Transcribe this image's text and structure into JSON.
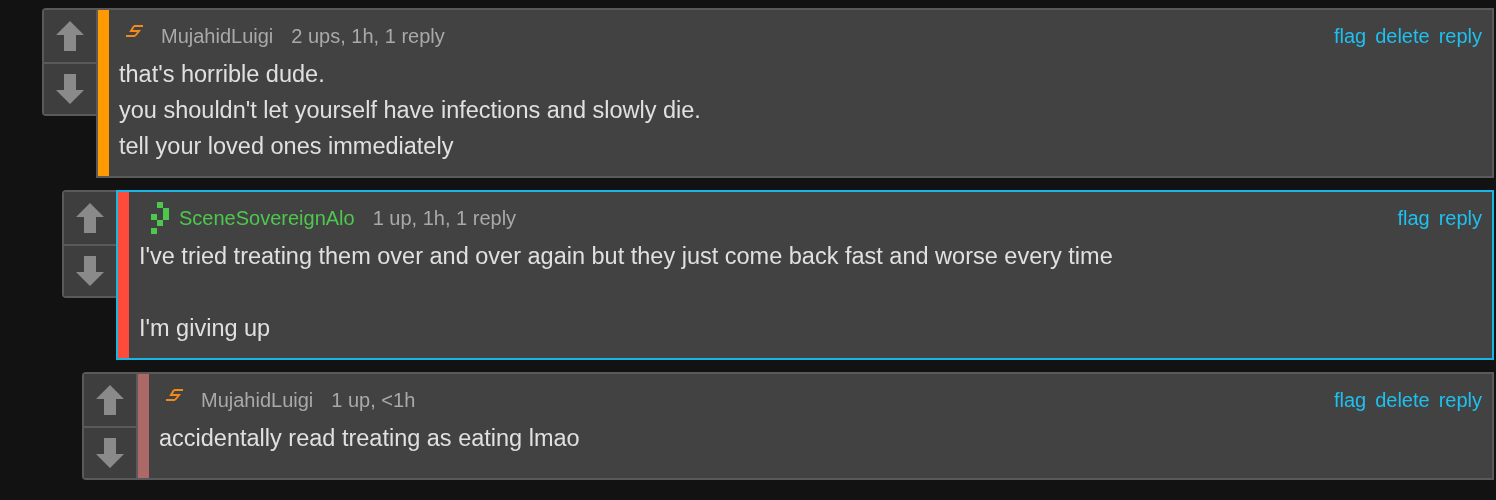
{
  "comments": [
    {
      "user": {
        "name": "MujahidLuigi",
        "kind": "bolt",
        "color": "#a9a9a9"
      },
      "color": "#ff9a00",
      "highlighted": false,
      "meta": "2 ups, 1h, 1 reply",
      "actions": [
        "flag",
        "delete",
        "reply"
      ],
      "paragraphs": [
        [
          "that's horrible dude.",
          "you shouldn't let yourself have infections and slowly die.",
          "tell your loved ones immediately"
        ]
      ],
      "children": [
        {
          "user": {
            "name": "SceneSovereignAlo",
            "kind": "pixel",
            "color": "#4cc94c"
          },
          "color": "#ff4b3a",
          "highlighted": true,
          "meta": "1 up, 1h, 1 reply",
          "actions": [
            "flag",
            "reply"
          ],
          "paragraphs": [
            [
              "I've tried treating them over and over again but they just come back fast and worse every time"
            ],
            [
              "I'm giving up"
            ]
          ],
          "children": [
            {
              "user": {
                "name": "MujahidLuigi",
                "kind": "bolt",
                "color": "#a9a9a9"
              },
              "color": "#ad6868",
              "highlighted": false,
              "meta": "1 up, <1h",
              "actions": [
                "flag",
                "delete",
                "reply"
              ],
              "paragraphs": [
                [
                  "accidentally read treating as eating lmao"
                ]
              ]
            }
          ]
        }
      ]
    }
  ]
}
